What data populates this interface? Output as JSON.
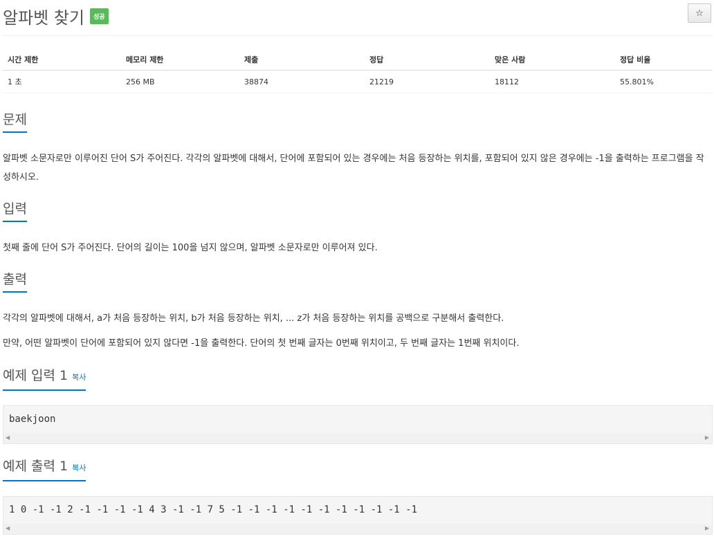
{
  "problem": {
    "title": "알파벳 찾기",
    "status_badge": "성공",
    "star_icon": "star-icon"
  },
  "info_table": {
    "headers": [
      "시간 제한",
      "메모리 제한",
      "제출",
      "정답",
      "맞은 사람",
      "정답 비율"
    ],
    "values": [
      "1 초",
      "256 MB",
      "38874",
      "21219",
      "18112",
      "55.801%"
    ]
  },
  "sections": {
    "description": {
      "heading": "문제",
      "text": "알파벳 소문자로만 이루어진 단어 S가 주어진다. 각각의 알파벳에 대해서, 단어에 포함되어 있는 경우에는 처음 등장하는 위치를, 포함되어 있지 않은 경우에는 -1을 출력하는 프로그램을 작성하시오."
    },
    "input": {
      "heading": "입력",
      "text": "첫째 줄에 단어 S가 주어진다. 단어의 길이는 100을 넘지 않으며, 알파벳 소문자로만 이루어져 있다."
    },
    "output": {
      "heading": "출력",
      "text1": "각각의 알파벳에 대해서, a가 처음 등장하는 위치, b가 처음 등장하는 위치, ... z가 처음 등장하는 위치를 공백으로 구분해서 출력한다.",
      "text2": "만약, 어떤 알파벳이 단어에 포함되어 있지 않다면 -1을 출력한다. 단어의 첫 번째 글자는 0번째 위치이고, 두 번째 글자는 1번째 위치이다."
    },
    "sample_input": {
      "heading": "예제 입력 1",
      "copy_label": "복사",
      "content": "baekjoon"
    },
    "sample_output": {
      "heading": "예제 출력 1",
      "copy_label": "복사",
      "content": "1 0 -1 -1 2 -1 -1 -1 -1 4 3 -1 -1 7 5 -1 -1 -1 -1 -1 -1 -1 -1 -1 -1 -1"
    }
  },
  "colors": {
    "accent": "#0076c0",
    "success_badge": "#5cb85c"
  }
}
